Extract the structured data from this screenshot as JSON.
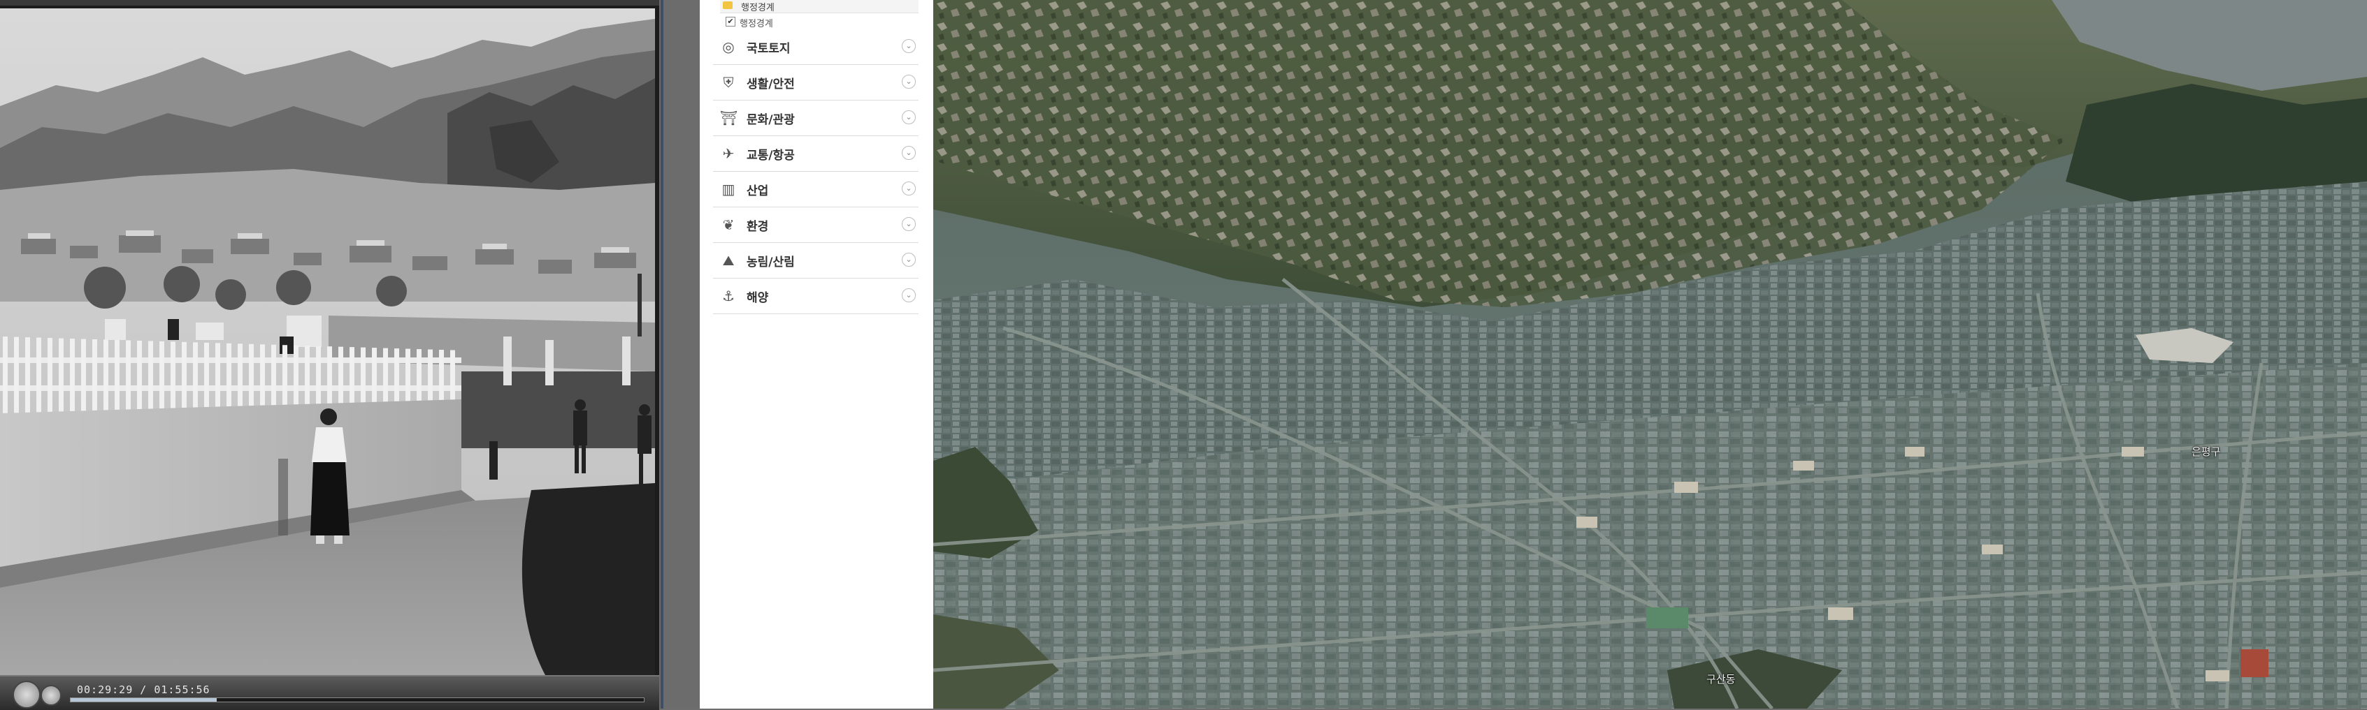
{
  "video": {
    "timecode": "00:29:29 / 01:55:56",
    "progress": 0.255
  },
  "layer_panel": {
    "sub_folder": {
      "label": "행정경계"
    },
    "sub_check": {
      "label": "행정경계",
      "checked": true
    },
    "categories": [
      {
        "label": "국토토지",
        "icon": "globe-icon"
      },
      {
        "label": "생활/안전",
        "icon": "shield-icon"
      },
      {
        "label": "문화/관광",
        "icon": "temple-icon"
      },
      {
        "label": "교통/항공",
        "icon": "plane-icon"
      },
      {
        "label": "산업",
        "icon": "factory-icon"
      },
      {
        "label": "환경",
        "icon": "leaf-icon"
      },
      {
        "label": "농림/산림",
        "icon": "mountain-icon"
      },
      {
        "label": "해양",
        "icon": "anchor-icon"
      }
    ]
  },
  "map": {
    "labels": [
      {
        "text": "은평구"
      },
      {
        "text": "구산동"
      }
    ]
  },
  "colors": {
    "panel_bg": "#ffffff",
    "gutter": "#6c6c6c",
    "folder": "#f1c542"
  }
}
